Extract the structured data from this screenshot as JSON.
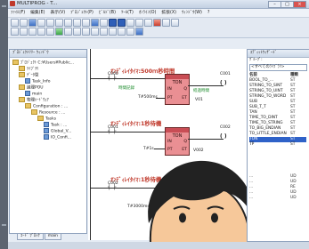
{
  "window": {
    "title": "MULTIPROG - T..."
  },
  "menu": [
    "ﾌｧｲﾙ(F)",
    "編集(E)",
    "表示(V)",
    "ﾌﾟﾛｼﾞｪｸﾄ(P)",
    "ﾋﾞﾙﾄﾞ(B)",
    "ﾂｰﾙ(T)",
    "ｵﾝﾗｲﾝ(O)",
    "拡張(X)",
    "ｳｨﾝﾄﾞｳ(W)",
    "?"
  ],
  "project_panel": {
    "header": "ﾌﾟﾛｼﾞｪｸﾄﾂﾘｰ ｳｨﾝﾄﾞｳ",
    "tree": [
      "ﾌﾟﾛｼﾞｪｸﾄ C:¥Users¥Public...",
      "ﾗｲﾌﾞﾗﾘ",
      "ﾃﾞｰﾀ型",
      "Task_Info",
      "論理POU",
      "main",
      "物理ﾊｰﾄﾞｳｪｱ",
      "Configuration : ...",
      "Resource : ...",
      "Tasks",
      "Task : ...",
      "Global_V...",
      "IO_Confi..."
    ]
  },
  "ladder": {
    "rung1_title": "ｵﾝﾃﾞｨﾚｲﾀｲﾏ:500ｍ秒時間",
    "rung1": {
      "contact": "C000",
      "in_label": "時間記録",
      "block_name": "TON",
      "pin_in": "IN",
      "pin_pt": "PT",
      "pin_q": "Q",
      "pin_et": "ET",
      "out_label": "経過時間",
      "coil": "C001",
      "time_var": "T#500ms",
      "out_var": "V01"
    },
    "rung2_title": "ｵﾝﾃﾞｨﾚｲﾀｲﾏ:1秒待機",
    "rung2": {
      "contact": "C001",
      "block_name": "TON",
      "pin_in": "IN",
      "pin_pt": "PT",
      "pin_q": "Q",
      "pin_et": "ET",
      "coil": "C002",
      "time_var": "T#1s",
      "out_var": "V002"
    },
    "rung3_title": "ｵﾝﾃﾞｨﾚｲﾀｲﾏ:1秒待機",
    "rung3": {
      "contact": "C002",
      "time_var": "T#3000ms"
    }
  },
  "edit_wizard": {
    "header": "ｴﾃﾞｨｯﾄｳｨｻﾞｰﾄﾞ",
    "group_label": "ｸﾞﾙｰﾌﾟ:",
    "group_value": "<すべてのﾗｲﾌﾞﾗﾘ>",
    "col_name": "名前",
    "col_type": "種類",
    "items": [
      {
        "name": "BOOL_TO_...",
        "kind": "ST"
      },
      {
        "name": "STRING_TO_SINT",
        "kind": "ST"
      },
      {
        "name": "STRING_TO_UINT",
        "kind": "ST"
      },
      {
        "name": "STRING_TO_WORD",
        "kind": "ST"
      },
      {
        "name": "SUB",
        "kind": "ST"
      },
      {
        "name": "SUB_T_T",
        "kind": "ST"
      },
      {
        "name": "TAN",
        "kind": "ST"
      },
      {
        "name": "TIME_TO_DINT",
        "kind": "ST"
      },
      {
        "name": "TIME_TO_STRING",
        "kind": "ST"
      },
      {
        "name": "TO_BIG_ENDIAN",
        "kind": "ST"
      },
      {
        "name": "TO_LITTLE_ENDIAN",
        "kind": "ST"
      },
      {
        "name": "TON",
        "kind": "ST"
      },
      {
        "name": "TP",
        "kind": "ST"
      },
      {
        "name": "...",
        "kind": "UD"
      },
      {
        "name": "...",
        "kind": "UD"
      },
      {
        "name": "...",
        "kind": "RE"
      },
      {
        "name": "...",
        "kind": "UD"
      },
      {
        "name": "...",
        "kind": "UD"
      }
    ]
  },
  "bottom_tabs": [
    "ｺｰﾄﾞ ﾌﾞﾛｯｸ",
    "main"
  ],
  "colors": {
    "accent": "#2f62c8",
    "fb_fill": "#ea8f93",
    "rung_title": "#c0392b",
    "var_green": "#1a8a2a"
  }
}
